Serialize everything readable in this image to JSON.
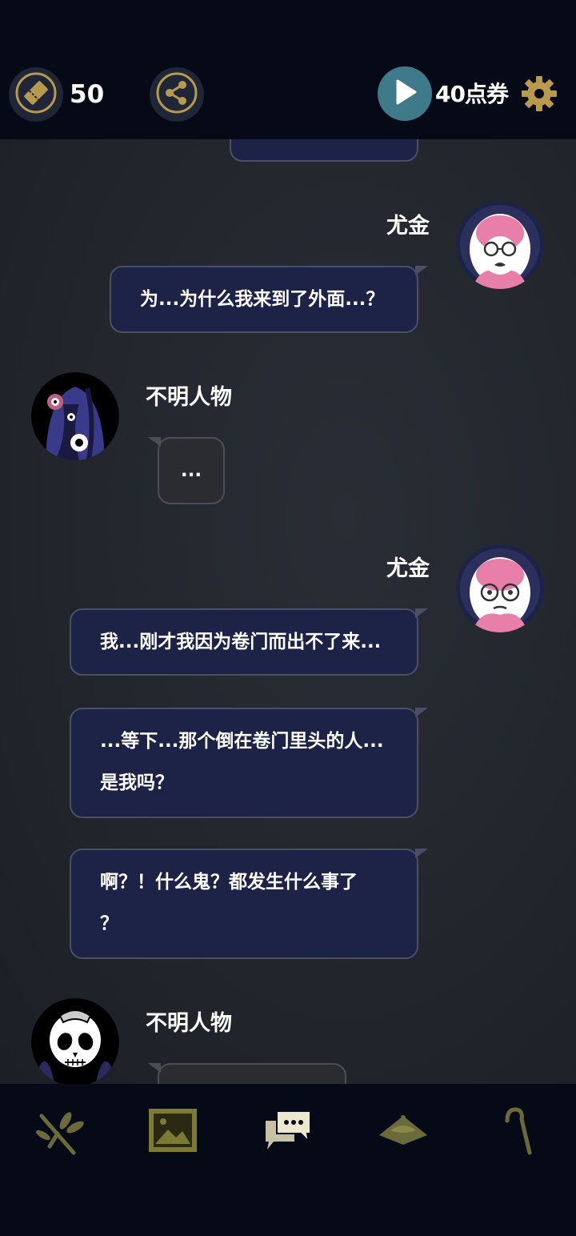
{
  "top_bar": {
    "ticket_count": "50",
    "points_label": "40点券",
    "icons": {
      "ticket": "ticket-icon",
      "share": "share-icon",
      "play": "play-icon",
      "settings": "gear-icon"
    }
  },
  "chat": {
    "messages": [
      {
        "speaker": "尤金",
        "side": "right",
        "text": "为...为什么我来到了外面...？"
      },
      {
        "speaker": "不明人物",
        "side": "left",
        "text": "..."
      },
      {
        "speaker": "尤金",
        "side": "right",
        "text": "我...刚才我因为卷门而出不了来..."
      },
      {
        "speaker": "尤金",
        "side": "right",
        "text_lines": [
          "...等下...那个倒在卷门里头的人...",
          "是我吗？"
        ]
      },
      {
        "speaker": "尤金",
        "side": "right",
        "text_lines": [
          "啊？！什么鬼？都发生什么事了",
          "？"
        ]
      },
      {
        "speaker": "不明人物",
        "side": "left",
        "text": ""
      }
    ]
  },
  "bottom_nav": {
    "items": [
      "branch-icon",
      "gallery-icon",
      "chat-icon",
      "hat-icon",
      "cane-icon"
    ]
  },
  "colors": {
    "background": "#070b17",
    "accent_gold": "#b99a4c",
    "bubble_blue": "#1d2247",
    "bubble_gray": "#2b2c30",
    "play_teal": "#3e7a8a"
  }
}
